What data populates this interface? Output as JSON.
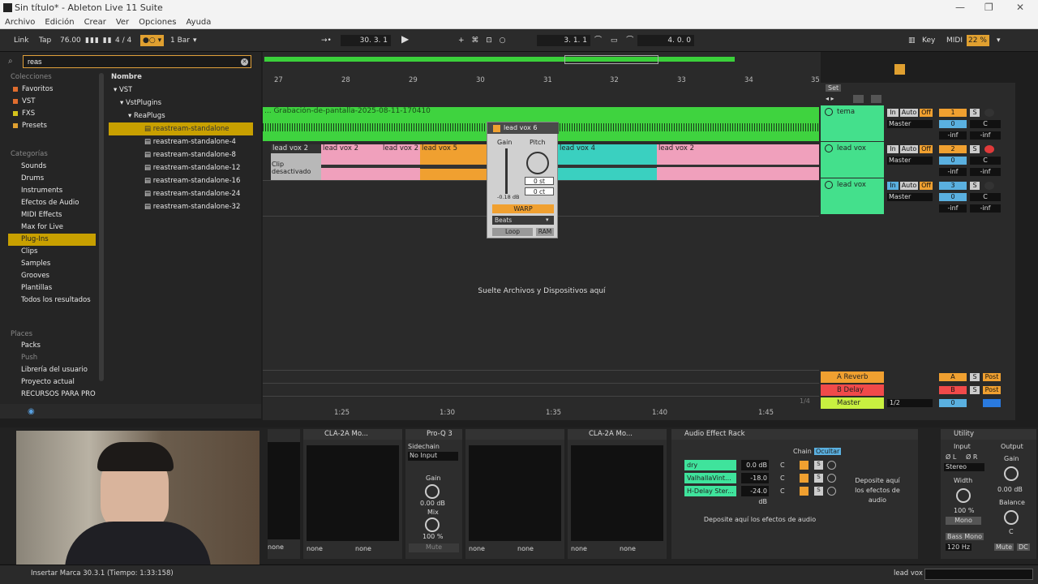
{
  "window": {
    "title": "Sin título* - Ableton Live 11 Suite",
    "minimize": "—",
    "maximize": "❐",
    "close": "✕"
  },
  "menu": [
    "Archivo",
    "Edición",
    "Crear",
    "Ver",
    "Opciones",
    "Ayuda"
  ],
  "transport": {
    "link": "Link",
    "tap": "Tap",
    "tempo": "76.00",
    "time_sig": "4 / 4",
    "quantize": "1 Bar",
    "loop_pos": "30.  3.  1",
    "song_pos": "3.  1.  1",
    "loop_len": "4.  0.  0",
    "key": "Key",
    "midi": "MIDI",
    "cpu": "22 %"
  },
  "browser": {
    "search_value": "reas",
    "collections_head": "Colecciones",
    "collections": [
      {
        "label": "Favoritos",
        "color": "#e06d2e"
      },
      {
        "label": "VST",
        "color": "#e06d2e"
      },
      {
        "label": "FXS",
        "color": "#d4c31c"
      },
      {
        "label": "Presets",
        "color": "#e0a030"
      }
    ],
    "categories_head": "Categorías",
    "categories": [
      "Sounds",
      "Drums",
      "Instruments",
      "Efectos de Audio",
      "MIDI Effects",
      "Max for Live",
      "Plug-Ins",
      "Clips",
      "Samples",
      "Grooves",
      "Plantillas",
      "Todos los resultados"
    ],
    "places_head": "Places",
    "places": [
      "Packs",
      "Push",
      "Librería del usuario",
      "Proyecto actual",
      "RECURSOS PARA PRO"
    ],
    "name_head": "Nombre",
    "tree": [
      "VST",
      "VstPlugins",
      "ReaPlugs"
    ],
    "files": [
      "reastream-standalone",
      "reastream-standalone-4",
      "reastream-standalone-8",
      "reastream-standalone-12",
      "reastream-standalone-16",
      "reastream-standalone-24",
      "reastream-standalone-32"
    ]
  },
  "arrangement": {
    "bars": [
      "27",
      "28",
      "29",
      "30",
      "31",
      "32",
      "33",
      "34",
      "35"
    ],
    "set": "Set",
    "screen_clip": "... Grabación-de-pantalla-2025-08-11-170410",
    "clips": [
      {
        "label": "lead vox 2",
        "color": "#b0b0b0"
      },
      {
        "label": "lead vox 2",
        "color": "#f0a0bc"
      },
      {
        "label": "lead vox 2",
        "color": "#f0a0bc"
      },
      {
        "label": "lead vox 5",
        "color": "#f0a030"
      },
      {
        "label": "lead vox 4",
        "color": "#3ad0c0"
      },
      {
        "label": "lead vox 2",
        "color": "#f0a0bc"
      }
    ],
    "deactivated": "Clip desactivado",
    "drop_text": "Suelte Archivos y Dispositivos aquí",
    "times": [
      "1:25",
      "1:30",
      "1:35",
      "1:40",
      "1:45"
    ],
    "page": "1/4"
  },
  "clip_popup": {
    "name": "lead vox 6",
    "gain": "Gain",
    "pitch": "Pitch",
    "semitones": "0 st",
    "cents": "0 ct",
    "gain_db": "-0.18 dB",
    "warp": "WARP",
    "mode": "Beats",
    "loop": "Loop",
    "ram": "RAM"
  },
  "tracks": [
    {
      "name": "tema",
      "color": "#44e08c",
      "num": "1",
      "route": "Master",
      "vol": "0",
      "pan": "C"
    },
    {
      "name": "lead vox",
      "color": "#44e08c",
      "num": "2",
      "route": "Master",
      "vol": "0",
      "pan": "C"
    },
    {
      "name": "lead vox",
      "color": "#44e08c",
      "num": "3",
      "route": "Master",
      "vol": "0",
      "pan": "C"
    }
  ],
  "track_buttons": {
    "in": "In",
    "auto": "Auto",
    "off": "Off",
    "solo": "S",
    "inf": "-inf"
  },
  "returns": [
    {
      "name": "A Reverb",
      "letter": "A",
      "color": "#f0a030",
      "post": "Post"
    },
    {
      "name": "B Delay",
      "letter": "B",
      "color": "#f04a4a",
      "post": "Post"
    }
  ],
  "master": {
    "name": "Master",
    "color": "#c8f040",
    "num": "0",
    "sel": "1/2"
  },
  "devices": {
    "cla1": "CLA-2A Mo...",
    "proq": "Pro-Q 3",
    "cla2": "CLA-2A Mo...",
    "rack": "Audio Effect Rack",
    "utility": "Utility",
    "sidechain": "Sidechain",
    "no_input": "No Input",
    "gain": "Gain",
    "gain_val": "0.00 dB",
    "mix": "Mix",
    "mix_val": "100 %",
    "mute": "Mute",
    "none": "none",
    "chain": "Chain",
    "hide": "Ocultar",
    "chains": [
      {
        "name": "dry",
        "db": "0.0 dB"
      },
      {
        "name": "ValhallaVint...",
        "db": "-18.0 dB"
      },
      {
        "name": "H-Delay Ster...",
        "db": "-24.0 dB"
      }
    ],
    "drop_fx": "Deposite aquí los efectos de audio",
    "util_input": "Input",
    "util_output": "Output",
    "util_l": "Ø L",
    "util_r": "Ø R",
    "util_stereo": "Stereo",
    "util_width": "Width",
    "util_width_val": "100 %",
    "util_mono": "Mono",
    "util_gain": "Gain",
    "util_gain_val": "0.00 dB",
    "util_balance": "Balance",
    "util_balance_val": "C",
    "util_bassmono": "Bass Mono",
    "util_hz": "120 Hz",
    "util_mute": "Mute",
    "util_dc": "DC"
  },
  "status": {
    "text": "Insertar Marca 30.3.1 (Tiempo: 1:33:158)",
    "track": "lead vox"
  }
}
